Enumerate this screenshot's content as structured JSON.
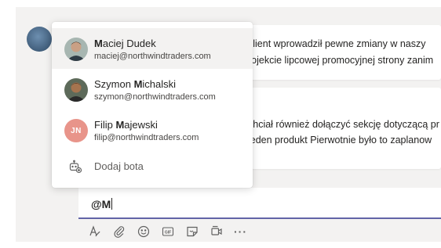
{
  "mentions": [
    {
      "name_bold": "M",
      "name_rest": "aciej Dudek",
      "name_prefix": "",
      "email": "maciej@northwindtraders.com",
      "avatar": "photo"
    },
    {
      "name_prefix": "Szymon ",
      "name_bold": "M",
      "name_rest": "ichalski",
      "email": "szymon@northwindtraders.com",
      "avatar": "photo"
    },
    {
      "name_prefix": "Filip ",
      "name_bold": "M",
      "name_rest": "ajewski",
      "email": "filip@northwindtraders.com",
      "avatar": "initials",
      "initials": "JN"
    }
  ],
  "add_bot_label": "Dodaj bota",
  "messages": {
    "msg1": [
      "klient wprowadził pewne zmiany w naszy",
      "rojekcie lipcowej promocyjnej strony zanim"
    ],
    "msg2": [
      "chciał również dołączyć sekcję dotyczącą pr",
      "jeden produkt Pierwotnie było to zaplanow"
    ]
  },
  "compose": {
    "text": "@M"
  },
  "toolbar": {
    "icons": [
      "format-icon",
      "attach-icon",
      "emoji-icon",
      "gif-icon",
      "sticker-icon",
      "meet-now-icon",
      "more-options-icon"
    ],
    "more_label": "···"
  },
  "colors": {
    "accent": "#6264a7",
    "initials_bg": "#e8948a"
  }
}
